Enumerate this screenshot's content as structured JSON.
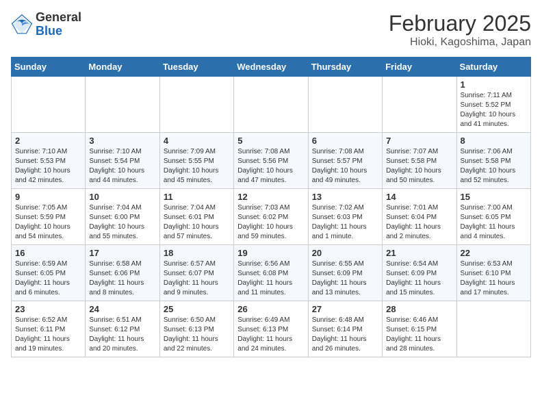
{
  "header": {
    "logo_general": "General",
    "logo_blue": "Blue",
    "title": "February 2025",
    "subtitle": "Hioki, Kagoshima, Japan"
  },
  "weekdays": [
    "Sunday",
    "Monday",
    "Tuesday",
    "Wednesday",
    "Thursday",
    "Friday",
    "Saturday"
  ],
  "weeks": [
    [
      {
        "day": "",
        "info": ""
      },
      {
        "day": "",
        "info": ""
      },
      {
        "day": "",
        "info": ""
      },
      {
        "day": "",
        "info": ""
      },
      {
        "day": "",
        "info": ""
      },
      {
        "day": "",
        "info": ""
      },
      {
        "day": "1",
        "info": "Sunrise: 7:11 AM\nSunset: 5:52 PM\nDaylight: 10 hours\nand 41 minutes."
      }
    ],
    [
      {
        "day": "2",
        "info": "Sunrise: 7:10 AM\nSunset: 5:53 PM\nDaylight: 10 hours\nand 42 minutes."
      },
      {
        "day": "3",
        "info": "Sunrise: 7:10 AM\nSunset: 5:54 PM\nDaylight: 10 hours\nand 44 minutes."
      },
      {
        "day": "4",
        "info": "Sunrise: 7:09 AM\nSunset: 5:55 PM\nDaylight: 10 hours\nand 45 minutes."
      },
      {
        "day": "5",
        "info": "Sunrise: 7:08 AM\nSunset: 5:56 PM\nDaylight: 10 hours\nand 47 minutes."
      },
      {
        "day": "6",
        "info": "Sunrise: 7:08 AM\nSunset: 5:57 PM\nDaylight: 10 hours\nand 49 minutes."
      },
      {
        "day": "7",
        "info": "Sunrise: 7:07 AM\nSunset: 5:58 PM\nDaylight: 10 hours\nand 50 minutes."
      },
      {
        "day": "8",
        "info": "Sunrise: 7:06 AM\nSunset: 5:58 PM\nDaylight: 10 hours\nand 52 minutes."
      }
    ],
    [
      {
        "day": "9",
        "info": "Sunrise: 7:05 AM\nSunset: 5:59 PM\nDaylight: 10 hours\nand 54 minutes."
      },
      {
        "day": "10",
        "info": "Sunrise: 7:04 AM\nSunset: 6:00 PM\nDaylight: 10 hours\nand 55 minutes."
      },
      {
        "day": "11",
        "info": "Sunrise: 7:04 AM\nSunset: 6:01 PM\nDaylight: 10 hours\nand 57 minutes."
      },
      {
        "day": "12",
        "info": "Sunrise: 7:03 AM\nSunset: 6:02 PM\nDaylight: 10 hours\nand 59 minutes."
      },
      {
        "day": "13",
        "info": "Sunrise: 7:02 AM\nSunset: 6:03 PM\nDaylight: 11 hours\nand 1 minute."
      },
      {
        "day": "14",
        "info": "Sunrise: 7:01 AM\nSunset: 6:04 PM\nDaylight: 11 hours\nand 2 minutes."
      },
      {
        "day": "15",
        "info": "Sunrise: 7:00 AM\nSunset: 6:05 PM\nDaylight: 11 hours\nand 4 minutes."
      }
    ],
    [
      {
        "day": "16",
        "info": "Sunrise: 6:59 AM\nSunset: 6:05 PM\nDaylight: 11 hours\nand 6 minutes."
      },
      {
        "day": "17",
        "info": "Sunrise: 6:58 AM\nSunset: 6:06 PM\nDaylight: 11 hours\nand 8 minutes."
      },
      {
        "day": "18",
        "info": "Sunrise: 6:57 AM\nSunset: 6:07 PM\nDaylight: 11 hours\nand 9 minutes."
      },
      {
        "day": "19",
        "info": "Sunrise: 6:56 AM\nSunset: 6:08 PM\nDaylight: 11 hours\nand 11 minutes."
      },
      {
        "day": "20",
        "info": "Sunrise: 6:55 AM\nSunset: 6:09 PM\nDaylight: 11 hours\nand 13 minutes."
      },
      {
        "day": "21",
        "info": "Sunrise: 6:54 AM\nSunset: 6:09 PM\nDaylight: 11 hours\nand 15 minutes."
      },
      {
        "day": "22",
        "info": "Sunrise: 6:53 AM\nSunset: 6:10 PM\nDaylight: 11 hours\nand 17 minutes."
      }
    ],
    [
      {
        "day": "23",
        "info": "Sunrise: 6:52 AM\nSunset: 6:11 PM\nDaylight: 11 hours\nand 19 minutes."
      },
      {
        "day": "24",
        "info": "Sunrise: 6:51 AM\nSunset: 6:12 PM\nDaylight: 11 hours\nand 20 minutes."
      },
      {
        "day": "25",
        "info": "Sunrise: 6:50 AM\nSunset: 6:13 PM\nDaylight: 11 hours\nand 22 minutes."
      },
      {
        "day": "26",
        "info": "Sunrise: 6:49 AM\nSunset: 6:13 PM\nDaylight: 11 hours\nand 24 minutes."
      },
      {
        "day": "27",
        "info": "Sunrise: 6:48 AM\nSunset: 6:14 PM\nDaylight: 11 hours\nand 26 minutes."
      },
      {
        "day": "28",
        "info": "Sunrise: 6:46 AM\nSunset: 6:15 PM\nDaylight: 11 hours\nand 28 minutes."
      },
      {
        "day": "",
        "info": ""
      }
    ]
  ]
}
